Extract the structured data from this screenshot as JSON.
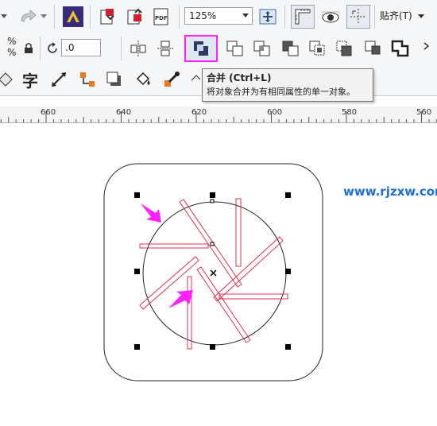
{
  "toolbar": {
    "zoom_value": "125%",
    "paste_label": "贴齐(T)",
    "percent_symbol": "%",
    "angle_value": ".0",
    "text_tool_glyph": "字"
  },
  "tooltip": {
    "title": "合并 (Ctrl+L)",
    "description": "将对象合并为有相同属性的单一对象。"
  },
  "ruler": {
    "labels": [
      "660",
      "640",
      "620",
      "600",
      "580",
      "560"
    ]
  },
  "watermark": "www.rjzxw.com",
  "colors": {
    "highlight": "#ff22ff",
    "pointer_arrow": "#ff22ff",
    "blade_stroke": "#e03050",
    "watermark": "#1d6fd6"
  },
  "icons": [
    "redo-icon",
    "export-icon",
    "import-icon",
    "publish-pdf-icon",
    "full-screen-icon",
    "rulers-icon",
    "view-icon",
    "guidelines-icon",
    "lock-icon",
    "rotate-icon",
    "align-icon",
    "distribute-icon",
    "weld-icon",
    "trim-icon",
    "intersect-icon",
    "simplify-icon",
    "front-minus-back-icon",
    "back-minus-front-icon",
    "boundary-icon",
    "text-tool-icon",
    "dimension-tool-icon",
    "connector-tool-icon",
    "drop-shadow-icon",
    "fill-tool-icon",
    "eyedropper-icon"
  ]
}
